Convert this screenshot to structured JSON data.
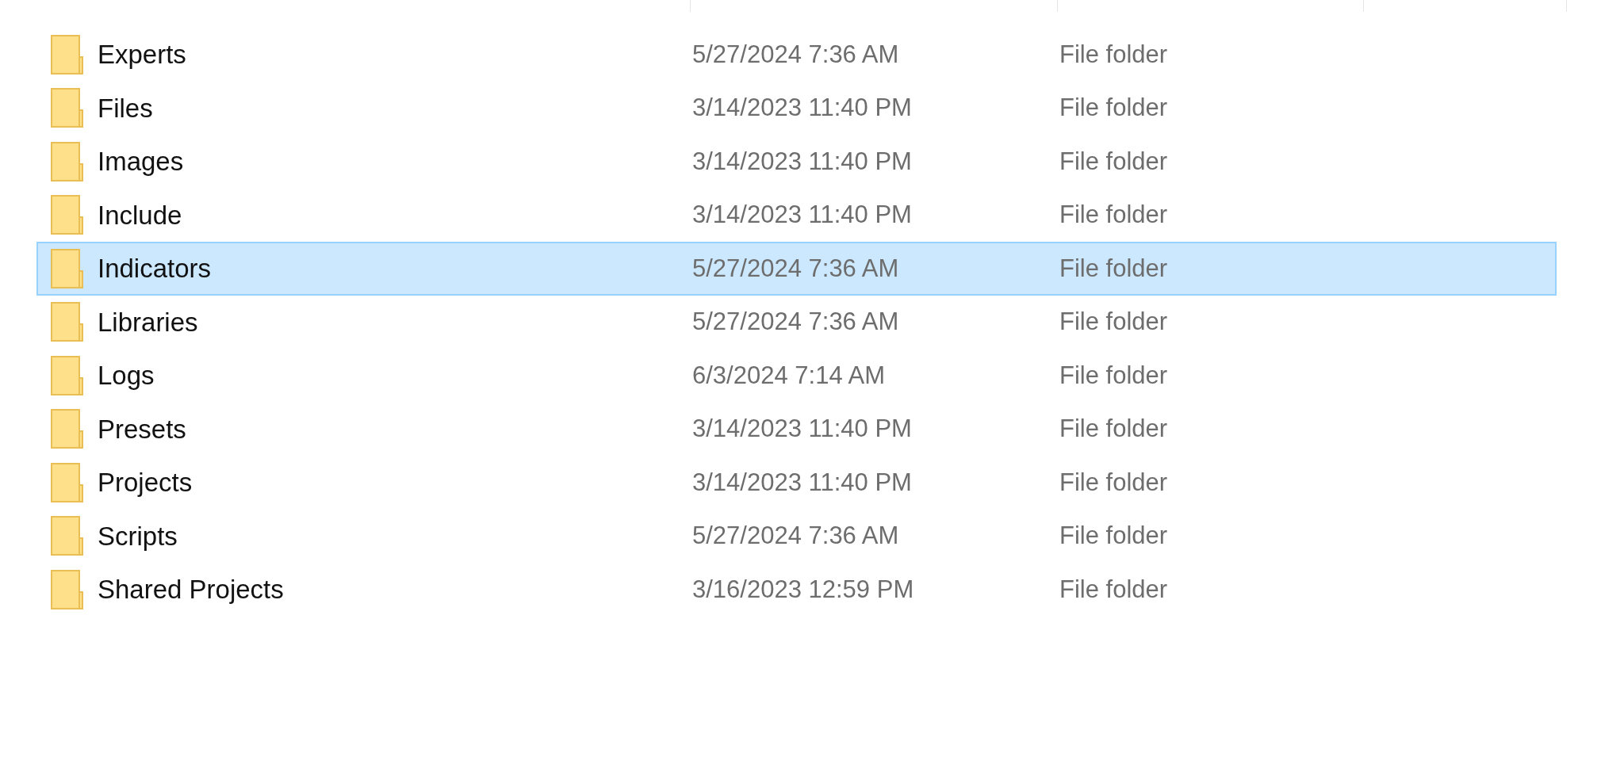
{
  "rows": [
    {
      "name": "Experts",
      "date_modified": "5/27/2024 7:36 AM",
      "type": "File folder",
      "selected": false
    },
    {
      "name": "Files",
      "date_modified": "3/14/2023 11:40 PM",
      "type": "File folder",
      "selected": false
    },
    {
      "name": "Images",
      "date_modified": "3/14/2023 11:40 PM",
      "type": "File folder",
      "selected": false
    },
    {
      "name": "Include",
      "date_modified": "3/14/2023 11:40 PM",
      "type": "File folder",
      "selected": false
    },
    {
      "name": "Indicators",
      "date_modified": "5/27/2024 7:36 AM",
      "type": "File folder",
      "selected": true
    },
    {
      "name": "Libraries",
      "date_modified": "5/27/2024 7:36 AM",
      "type": "File folder",
      "selected": false
    },
    {
      "name": "Logs",
      "date_modified": "6/3/2024 7:14 AM",
      "type": "File folder",
      "selected": false
    },
    {
      "name": "Presets",
      "date_modified": "3/14/2023 11:40 PM",
      "type": "File folder",
      "selected": false
    },
    {
      "name": "Projects",
      "date_modified": "3/14/2023 11:40 PM",
      "type": "File folder",
      "selected": false
    },
    {
      "name": "Scripts",
      "date_modified": "5/27/2024 7:36 AM",
      "type": "File folder",
      "selected": false
    },
    {
      "name": "Shared Projects",
      "date_modified": "3/16/2023 12:59 PM",
      "type": "File folder",
      "selected": false
    }
  ]
}
